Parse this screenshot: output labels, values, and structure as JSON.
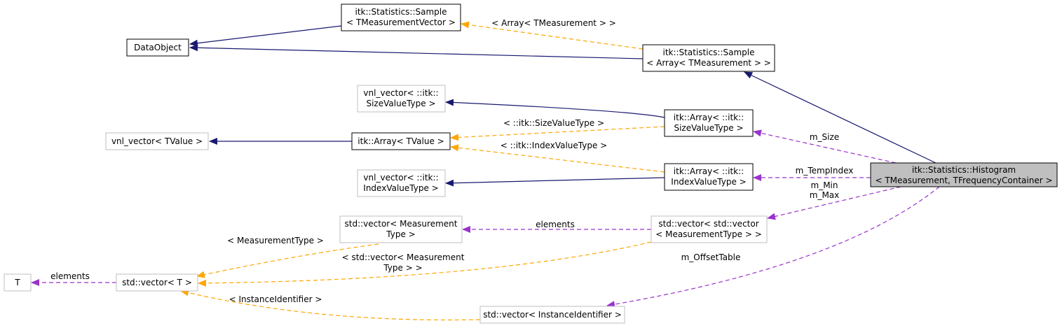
{
  "nodes": {
    "dataobject": {
      "lines": [
        "DataObject"
      ]
    },
    "sample_vec": {
      "lines": [
        "itk::Statistics::Sample",
        "< TMeasurementVector >"
      ]
    },
    "sample_arr": {
      "lines": [
        "itk::Statistics::Sample",
        "< Array< TMeasurement > >"
      ]
    },
    "vnl_size": {
      "lines": [
        "vnl_vector< ::itk::",
        "SizeValueType >"
      ]
    },
    "array_size": {
      "lines": [
        "itk::Array< ::itk::",
        "SizeValueType >"
      ]
    },
    "vnl_tvalue": {
      "lines": [
        "vnl_vector< TValue >"
      ]
    },
    "array_tvalue": {
      "lines": [
        "itk::Array< TValue >"
      ]
    },
    "vnl_index": {
      "lines": [
        "vnl_vector< ::itk::",
        "IndexValueType >"
      ]
    },
    "array_index": {
      "lines": [
        "itk::Array< ::itk::",
        "IndexValueType >"
      ]
    },
    "histogram": {
      "lines": [
        "itk::Statistics::Histogram",
        "< TMeasurement, TFrequencyContainer >"
      ]
    },
    "vec_meas": {
      "lines": [
        "std::vector< Measurement",
        "Type >"
      ]
    },
    "vec_vec_meas": {
      "lines": [
        "std::vector< std::vector",
        "< MeasurementType > >"
      ]
    },
    "t": {
      "lines": [
        "T"
      ]
    },
    "vec_t": {
      "lines": [
        "std::vector< T >"
      ]
    },
    "vec_inst": {
      "lines": [
        "std::vector< InstanceIdentifier >"
      ]
    }
  },
  "edge_labels": {
    "array_tmeasurement": [
      "< Array< TMeasurement > >"
    ],
    "size_value_type": [
      "< ::itk::SizeValueType >"
    ],
    "index_value_type": [
      "< ::itk::IndexValueType >"
    ],
    "m_size": [
      "m_Size"
    ],
    "m_temp_index": [
      "m_TempIndex"
    ],
    "m_min_max": [
      "m_Min",
      "m_Max"
    ],
    "elements_vec": [
      "elements"
    ],
    "measurement_type": [
      "< MeasurementType >"
    ],
    "vec_measurement_type": [
      "< std::vector< Measurement",
      "Type > >"
    ],
    "m_offset_table": [
      "m_OffsetTable"
    ],
    "elements_t": [
      "elements"
    ],
    "instance_identifier": [
      "< InstanceIdentifier >"
    ]
  },
  "colors": {
    "inheritance": "#191970",
    "template": "#ffa500",
    "usage": "#9a32cd",
    "focus_fill": "#bfbfbf"
  }
}
